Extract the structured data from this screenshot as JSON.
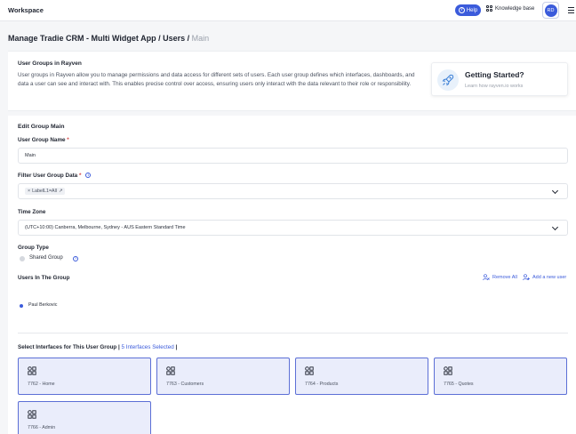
{
  "topbar": {
    "workspace": "Workspace",
    "help": "Help",
    "knowledge_base": "Knowledge base",
    "avatar_initials": "RD"
  },
  "breadcrumb": {
    "part1": "Manage Tradie CRM - Multi Widget App",
    "sep1": " / ",
    "part2": "Users",
    "sep2": " / ",
    "current": "Main"
  },
  "info": {
    "title": "User Groups in Rayven",
    "text": "User groups in Rayven allow you to manage permissions and data access for different sets of users. Each user group defines which interfaces, dashboards, and data a user can see and interact with. This enables precise control over access, ensuring users only interact with the data relevant to their role or responsibility.",
    "getting_started_title": "Getting Started?",
    "getting_started_sub": "Learn how rayven.io works"
  },
  "form": {
    "section_title": "Edit Group Main",
    "name_label": "User Group Name",
    "required_mark": "*",
    "name_value": "Main",
    "filter_label": "Filter User Group Data",
    "filter_chip": "LabelL1=All",
    "timezone_label": "Time Zone",
    "timezone_value": "(UTC+10:00) Canberra, Melbourne, Sydney - AUS Eastern Standard Time",
    "group_type_label": "Group Type",
    "group_type_option": "Shared Group",
    "users_label": "Users In The Group",
    "remove_all": "Remove All",
    "add_user": "Add a new user",
    "users": [
      "Paul Berkovic"
    ],
    "interfaces_title": "Select Interfaces for This User Group",
    "interfaces_bar_left": " | ",
    "interfaces_selected": "5 Interfaces Selected",
    "interfaces_bar_right": " |",
    "interfaces": [
      {
        "label": "7762 - Home"
      },
      {
        "label": "7763 - Customers"
      },
      {
        "label": "7764 - Products"
      },
      {
        "label": "7765 - Quotes"
      },
      {
        "label": "7766 - Admin"
      }
    ]
  },
  "colors": {
    "accent": "#3b5bdb",
    "tile_bg": "#eaedfb",
    "tile_border": "#5c6fd6"
  }
}
